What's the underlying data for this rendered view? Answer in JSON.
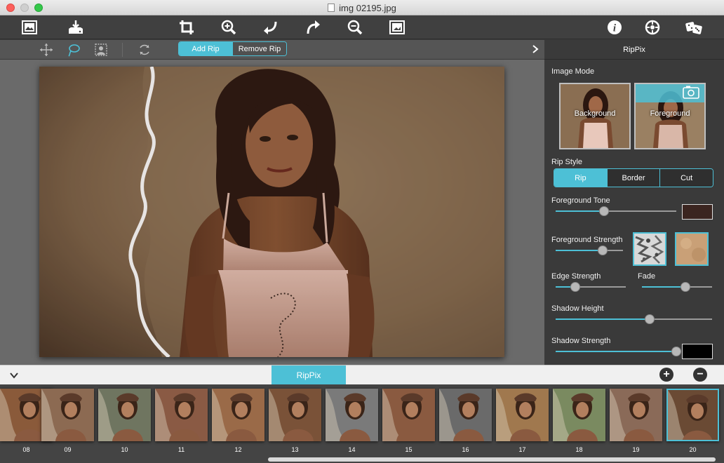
{
  "window": {
    "title": "img 02195.jpg"
  },
  "toolbar": {
    "icons": [
      "open-image-icon",
      "save-icon",
      "crop-icon",
      "zoom-in-icon",
      "undo-icon",
      "redo-icon",
      "zoom-out-icon",
      "fit-image-icon",
      "info-icon",
      "settings-icon",
      "dice-icon"
    ]
  },
  "subbar": {
    "tools": [
      "move-icon",
      "lasso-icon",
      "portrait-select-icon",
      "refresh-icon"
    ],
    "rip_mode": {
      "add": "Add Rip",
      "remove": "Remove Rip",
      "selected": "Add Rip"
    }
  },
  "panel": {
    "title": "RipPix",
    "image_mode": {
      "label": "Image Mode",
      "background": "Background",
      "foreground": "Foreground",
      "selected": "Foreground"
    },
    "rip_style": {
      "label": "Rip Style",
      "options": [
        "Rip",
        "Border",
        "Cut"
      ],
      "selected": "Rip"
    },
    "foreground_tone": {
      "label": "Foreground Tone",
      "value": 0.4,
      "color": "#3b2520"
    },
    "foreground_strength": {
      "label": "Foreground Strength",
      "value": 0.7
    },
    "edge_strength": {
      "label": "Edge Strength",
      "value": 0.28
    },
    "fade": {
      "label": "Fade",
      "value": 0.62
    },
    "shadow_height": {
      "label": "Shadow Height",
      "value": 0.6
    },
    "shadow_strength": {
      "label": "Shadow Strength",
      "value": 1.0,
      "color": "#000000"
    }
  },
  "bottom": {
    "tab": "RipPix",
    "add": "+",
    "remove": "−"
  },
  "filmstrip": {
    "frames": [
      "08",
      "09",
      "10",
      "11",
      "12",
      "13",
      "14",
      "15",
      "16",
      "17",
      "18",
      "19",
      "20"
    ],
    "selected": "20"
  },
  "colors": {
    "accent": "#4dc0d6"
  }
}
